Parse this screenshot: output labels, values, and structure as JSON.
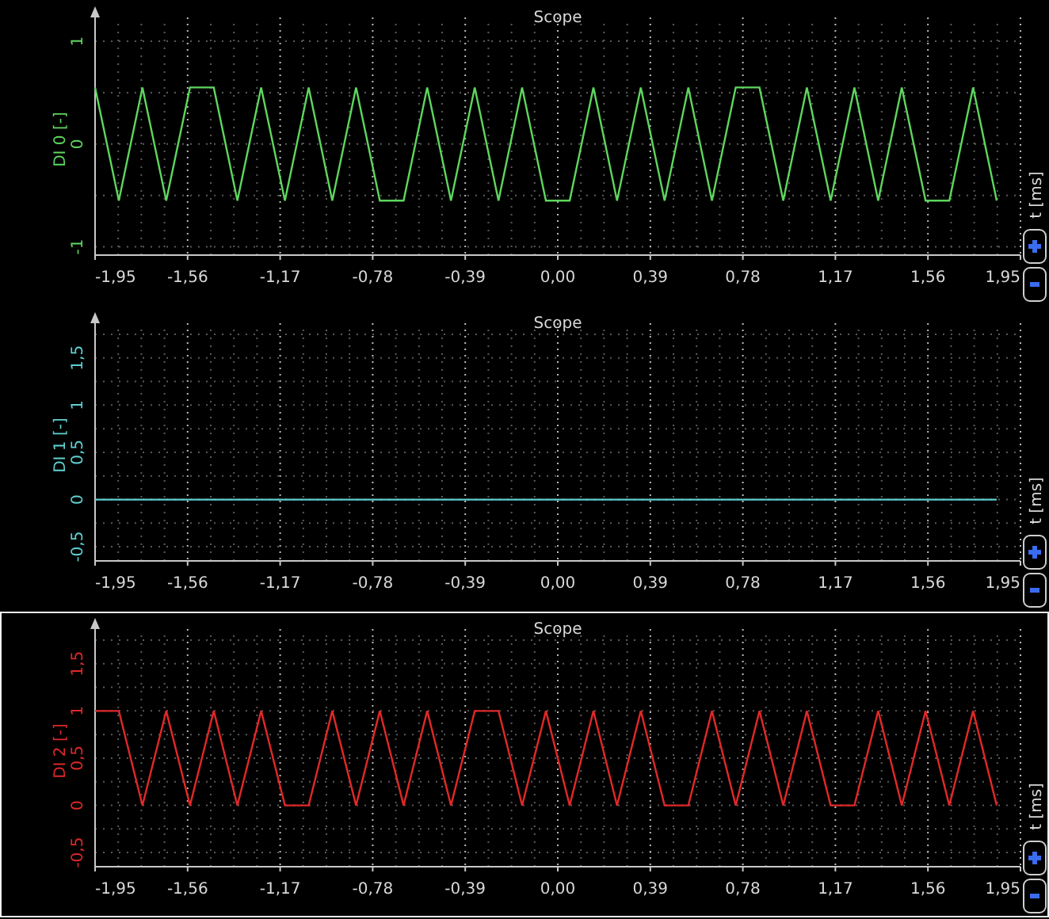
{
  "panels": [
    {
      "selected": false,
      "time_axis_label": "t [ms]",
      "chart_data": {
        "type": "line",
        "grid": true,
        "title": "Scope",
        "ylabel": "DI 0 [-]",
        "xlim": [
          -1.95,
          1.95
        ],
        "ylim": [
          -1.08,
          1.17
        ],
        "x": [
          -1.95,
          -1.85,
          -1.75,
          -1.65,
          -1.55,
          -1.45,
          -1.35,
          -1.25,
          -1.15,
          -1.05,
          -0.95,
          -0.85,
          -0.75,
          -0.65,
          -0.55,
          -0.45,
          -0.35,
          -0.25,
          -0.15,
          -0.05,
          0.05,
          0.15,
          0.25,
          0.35,
          0.45,
          0.55,
          0.65,
          0.75,
          0.85,
          0.95,
          1.05,
          1.15,
          1.25,
          1.35,
          1.45,
          1.55,
          1.65,
          1.75,
          1.85
        ],
        "series": [
          {
            "color": "#5ed65e",
            "values": [
              0.55,
              -0.55,
              0.55,
              -0.55,
              0.55,
              0.55,
              -0.55,
              0.55,
              -0.55,
              0.55,
              -0.55,
              0.55,
              -0.55,
              -0.55,
              0.55,
              -0.55,
              0.55,
              -0.55,
              0.55,
              -0.55,
              -0.55,
              0.55,
              -0.55,
              0.55,
              -0.55,
              0.55,
              -0.55,
              0.55,
              0.55,
              -0.55,
              0.55,
              -0.55,
              0.55,
              -0.55,
              0.55,
              -0.55,
              -0.55,
              0.55,
              -0.55
            ]
          }
        ],
        "xticks": [
          {
            "value": -1.95,
            "label": "-1,95"
          },
          {
            "value": -1.56,
            "label": "-1,56"
          },
          {
            "value": -1.17,
            "label": "-1,17"
          },
          {
            "value": -0.78,
            "label": "-0,78"
          },
          {
            "value": -0.39,
            "label": "-0,39"
          },
          {
            "value": 0,
            "label": "0,00"
          },
          {
            "value": 0.39,
            "label": "0,39"
          },
          {
            "value": 0.78,
            "label": "0,78"
          },
          {
            "value": 1.17,
            "label": "1,17"
          },
          {
            "value": 1.56,
            "label": "1,56"
          },
          {
            "value": 1.95,
            "label": "1,95"
          }
        ],
        "yticks": [
          {
            "value": -1,
            "label": "-1"
          },
          {
            "value": 0,
            "label": "0"
          },
          {
            "value": 1,
            "label": "1"
          }
        ]
      }
    },
    {
      "selected": false,
      "time_axis_label": "t [ms]",
      "chart_data": {
        "type": "line",
        "grid": true,
        "title": "Scope",
        "ylabel": "DI 1 [-]",
        "xlim": [
          -1.95,
          1.95
        ],
        "ylim": [
          -0.65,
          1.8
        ],
        "x": [
          -1.95,
          1.85
        ],
        "series": [
          {
            "color": "#5fd0d0",
            "values": [
              0,
              0
            ]
          }
        ],
        "xticks": [
          {
            "value": -1.95,
            "label": "-1,95"
          },
          {
            "value": -1.56,
            "label": "-1,56"
          },
          {
            "value": -1.17,
            "label": "-1,17"
          },
          {
            "value": -0.78,
            "label": "-0,78"
          },
          {
            "value": -0.39,
            "label": "-0,39"
          },
          {
            "value": 0,
            "label": "0,00"
          },
          {
            "value": 0.39,
            "label": "0,39"
          },
          {
            "value": 0.78,
            "label": "0,78"
          },
          {
            "value": 1.17,
            "label": "1,17"
          },
          {
            "value": 1.56,
            "label": "1,56"
          },
          {
            "value": 1.95,
            "label": "1,95"
          }
        ],
        "yticks": [
          {
            "value": -0.5,
            "label": "-0,5"
          },
          {
            "value": 0,
            "label": "0"
          },
          {
            "value": 0.5,
            "label": "0,5"
          },
          {
            "value": 1,
            "label": "1"
          },
          {
            "value": 1.5,
            "label": "1,5"
          }
        ]
      }
    },
    {
      "selected": true,
      "time_axis_label": "t [ms]",
      "chart_data": {
        "type": "line",
        "grid": true,
        "title": "Scope",
        "ylabel": "DI 2 [-]",
        "xlim": [
          -1.95,
          1.95
        ],
        "ylim": [
          -0.65,
          1.8
        ],
        "x": [
          -1.95,
          -1.85,
          -1.75,
          -1.65,
          -1.55,
          -1.45,
          -1.35,
          -1.25,
          -1.15,
          -1.05,
          -0.95,
          -0.85,
          -0.75,
          -0.65,
          -0.55,
          -0.45,
          -0.35,
          -0.25,
          -0.15,
          -0.05,
          0.05,
          0.15,
          0.25,
          0.35,
          0.45,
          0.55,
          0.65,
          0.75,
          0.85,
          0.95,
          1.05,
          1.15,
          1.25,
          1.35,
          1.45,
          1.55,
          1.65,
          1.75,
          1.85
        ],
        "series": [
          {
            "color": "#e02828",
            "values": [
              1,
              1,
              0,
              1,
              0,
              1,
              0,
              1,
              0,
              0,
              1,
              0,
              1,
              0,
              1,
              0,
              1,
              1,
              0,
              1,
              0,
              1,
              0,
              1,
              0,
              0,
              1,
              0,
              1,
              0,
              1,
              0,
              0,
              1,
              0,
              1,
              0,
              1,
              0
            ]
          }
        ],
        "xticks": [
          {
            "value": -1.95,
            "label": "-1,95"
          },
          {
            "value": -1.56,
            "label": "-1,56"
          },
          {
            "value": -1.17,
            "label": "-1,17"
          },
          {
            "value": -0.78,
            "label": "-0,78"
          },
          {
            "value": -0.39,
            "label": "-0,39"
          },
          {
            "value": 0,
            "label": "0,00"
          },
          {
            "value": 0.39,
            "label": "0,39"
          },
          {
            "value": 0.78,
            "label": "0,78"
          },
          {
            "value": 1.17,
            "label": "1,17"
          },
          {
            "value": 1.56,
            "label": "1,56"
          },
          {
            "value": 1.95,
            "label": "1,95"
          }
        ],
        "yticks": [
          {
            "value": -0.5,
            "label": "-0,5"
          },
          {
            "value": 0,
            "label": "0"
          },
          {
            "value": 0.5,
            "label": "0,5"
          },
          {
            "value": 1,
            "label": "1"
          },
          {
            "value": 1.5,
            "label": "1,5"
          }
        ]
      }
    }
  ]
}
